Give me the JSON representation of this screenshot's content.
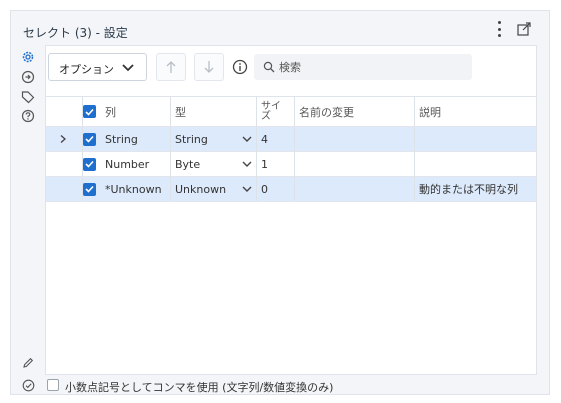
{
  "panel": {
    "title": "セレクト (3) - 設定"
  },
  "toolbar": {
    "options_label": "オプション",
    "search_placeholder": "検索"
  },
  "grid": {
    "headers": {
      "column": "列",
      "type": "型",
      "size": "サイズ",
      "rename": "名前の変更",
      "description": "説明"
    },
    "size_header_line1": "サイ",
    "size_header_line2": "ズ",
    "rows": [
      {
        "selected": true,
        "expandable": true,
        "checked": true,
        "column": "String",
        "type": "String",
        "size": "4",
        "rename": "",
        "description": ""
      },
      {
        "selected": false,
        "expandable": false,
        "checked": true,
        "column": "Number",
        "type": "Byte",
        "size": "1",
        "rename": "",
        "description": ""
      },
      {
        "selected": true,
        "expandable": false,
        "checked": true,
        "column": "*Unknown",
        "type": "Unknown",
        "size": "0",
        "rename": "",
        "description": "動的または不明な列"
      }
    ]
  },
  "footer": {
    "decimal_option_label": "小数点記号としてコンマを使用 (文字列/数値変換のみ)",
    "decimal_option_checked": false
  },
  "colors": {
    "accent": "#1f6fce",
    "selected_row": "#ddeafb",
    "panel_bg": "#f3f5f8"
  }
}
